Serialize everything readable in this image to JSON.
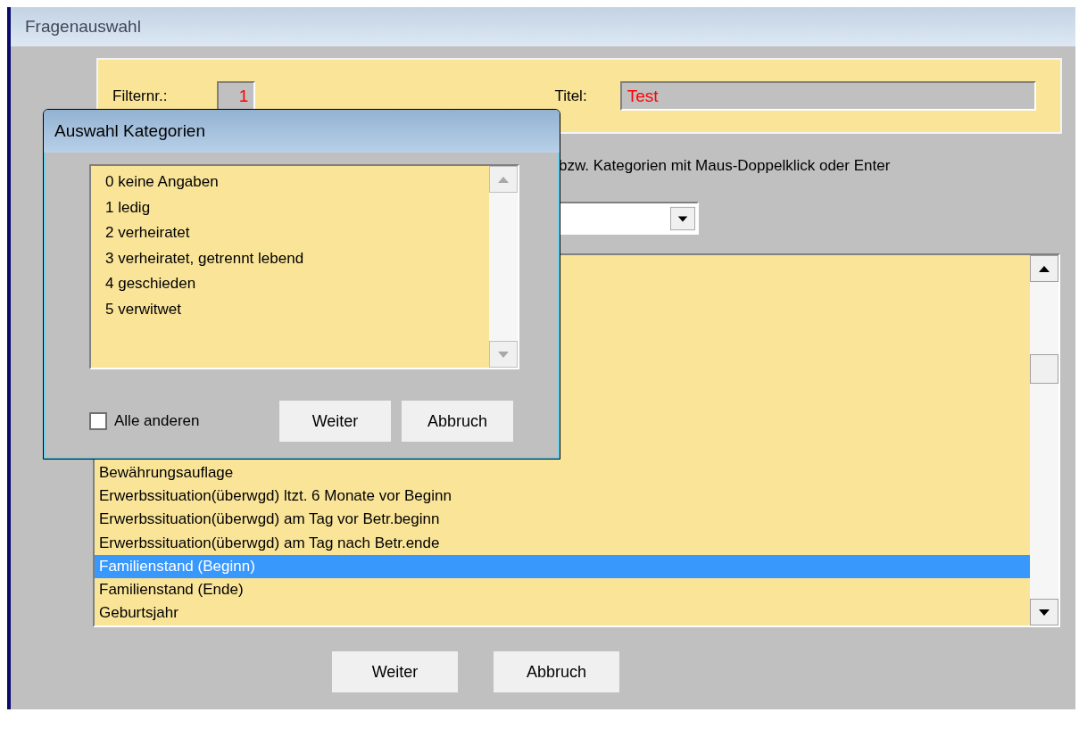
{
  "window": {
    "title": "Fragenauswahl"
  },
  "filter": {
    "number_label": "Filternr.:",
    "number": "1",
    "title_label": "Titel:",
    "title": "Test"
  },
  "instruction": "bzw. Kategorien mit Maus-Doppelklick oder Enter",
  "question_list": {
    "items": [
      {
        "label": "Bewährungsauflage",
        "selected": false
      },
      {
        "label": "Erwerbssituation(überwgd) ltzt. 6 Monate vor Beginn",
        "selected": false
      },
      {
        "label": "Erwerbssituation(überwgd) am Tag vor Betr.beginn",
        "selected": false
      },
      {
        "label": "Erwerbssituation(überwgd) am Tag nach Betr.ende",
        "selected": false
      },
      {
        "label": "Familienstand (Beginn)",
        "selected": true
      },
      {
        "label": "Familienstand (Ende)",
        "selected": false
      },
      {
        "label": "Geburtsjahr",
        "selected": false
      }
    ]
  },
  "buttons": [
    "Weiter",
    "Abbruch"
  ],
  "dialog": {
    "title": "Auswahl Kategorien",
    "categories": [
      "0 keine Angaben",
      "1 ledig",
      "2 verheiratet",
      "3 verheiratet, getrennt lebend",
      "4 geschieden",
      "5 verwitwet"
    ],
    "all_others": {
      "label": "Alle anderen",
      "checked": false
    },
    "buttons": [
      "Weiter",
      "Abbruch"
    ]
  }
}
